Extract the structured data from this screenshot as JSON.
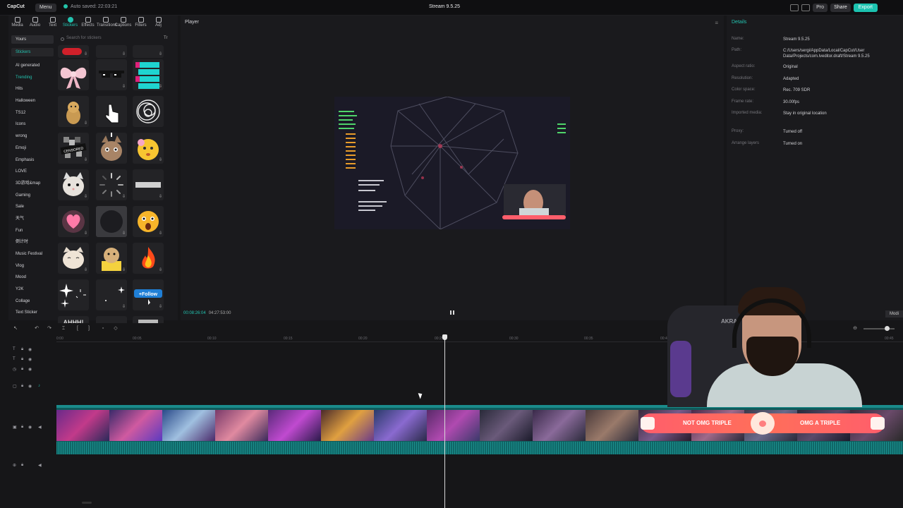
{
  "titlebar": {
    "logo": "CapCut",
    "menu_label": "Menu",
    "autosave": "Auto saved: 22:03:21",
    "window_title": "Stream 9.5.25",
    "pro_label": "Pro",
    "share_label": "Share",
    "export_label": "Export"
  },
  "left_panel": {
    "tabs": [
      {
        "label": "Media"
      },
      {
        "label": "Audio"
      },
      {
        "label": "Text"
      },
      {
        "label": "Stickers"
      },
      {
        "label": "Effects"
      },
      {
        "label": "Transitions"
      },
      {
        "label": "Captions"
      },
      {
        "label": "Filters"
      },
      {
        "label": "Adj"
      }
    ],
    "active_tab": "Stickers",
    "dropdown_value": "Yours",
    "section_label": "Stickers",
    "search_placeholder": "Search for stickers",
    "filter_label": "Tr",
    "categories": [
      "AI generated",
      "Trending",
      "Hits",
      "Halloween",
      "TS12",
      "Icons",
      "wrong",
      "Emoji",
      "Emphasis",
      "LOVE",
      "3D游戏&map",
      "Gaming",
      "Sale",
      "天气",
      "Fun",
      "倒计时",
      "Music Festival",
      "Vlog",
      "Mood",
      "Y2K",
      "Collage",
      "Text Sticker"
    ],
    "active_category": "Trending",
    "sticker_texts": {
      "censored": "CENSORED",
      "follow": "+Follow",
      "ahhh": "AHHH!"
    }
  },
  "player": {
    "title": "Player",
    "current_time": "00:08:26:04",
    "total_time": "04:27:53:00"
  },
  "details": {
    "title": "Details",
    "rows": [
      {
        "label": "Name:",
        "value": "Stream 9.5.25"
      },
      {
        "label": "Path:",
        "value": "C:/Users/sergi/AppData/Local/CapCut/User Data/Projects/com.lveditor.draft/Stream 9.5.25"
      },
      {
        "label": "Aspect ratio:",
        "value": "Original"
      },
      {
        "label": "Resolution:",
        "value": "Adapted"
      },
      {
        "label": "Color space:",
        "value": "Rec. 709 SDR"
      },
      {
        "label": "Frame rate:",
        "value": "30.00fps"
      },
      {
        "label": "Imported media:",
        "value": "Stay in original location"
      },
      {
        "label": "Proxy:",
        "value": "Turned off"
      },
      {
        "label": "Arrange layers",
        "value": "Turned on"
      }
    ],
    "mode_label": "Modi"
  },
  "timeline": {
    "ruler_ticks": [
      "0:00",
      "00:05",
      "00:10",
      "00:15",
      "00:20",
      "00:25",
      "00:30",
      "00:35",
      "00:40",
      "00:45"
    ],
    "banner_left": "NOT OMG TRIPLE",
    "banner_right": "OMG A TRIPLE"
  },
  "webcam": {
    "chair_brand": "AKRA"
  },
  "colors": {
    "accent": "#23c3b0",
    "track": "#0f5b5b",
    "banner": "#ff5e6b"
  }
}
